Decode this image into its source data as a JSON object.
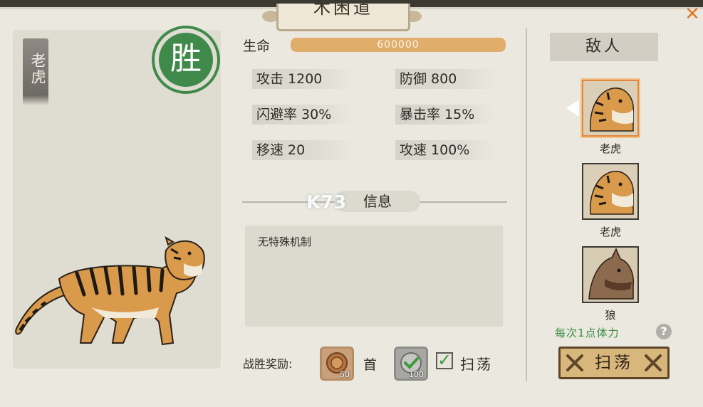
{
  "window": {
    "title": "木困道"
  },
  "portrait": {
    "name": "老虎",
    "result_badge": "胜"
  },
  "stats": {
    "life_label": "生命",
    "life_value": "600000",
    "life_fill": 1.0,
    "attack": "攻击 1200",
    "defense": "防御 800",
    "dodge": "闪避率 30%",
    "crit": "暴击率 15%",
    "move_speed": "移速 20",
    "attack_speed": "攻速 100%"
  },
  "info": {
    "section_title": "信息",
    "description": "无特殊机制",
    "watermark": "K73"
  },
  "reward": {
    "label": "战胜奖励:",
    "coin_count": "50",
    "first_tag": "首",
    "silver_count": "100",
    "sweep_label": "扫荡",
    "sweep_checked": true
  },
  "enemies": {
    "header": "敌人",
    "list": [
      {
        "name": "老虎",
        "selected": true
      },
      {
        "name": "老虎",
        "selected": false
      },
      {
        "name": "狼",
        "selected": false
      }
    ],
    "stamina_text": "每次1点体力",
    "help_icon": "question-icon",
    "sweep_button": "扫荡"
  },
  "colors": {
    "life_bar": "#e1ad6a",
    "win_badge": "#3f8a4a",
    "stamina_text": "#3a8e43",
    "selected_border": "#e2893e"
  }
}
